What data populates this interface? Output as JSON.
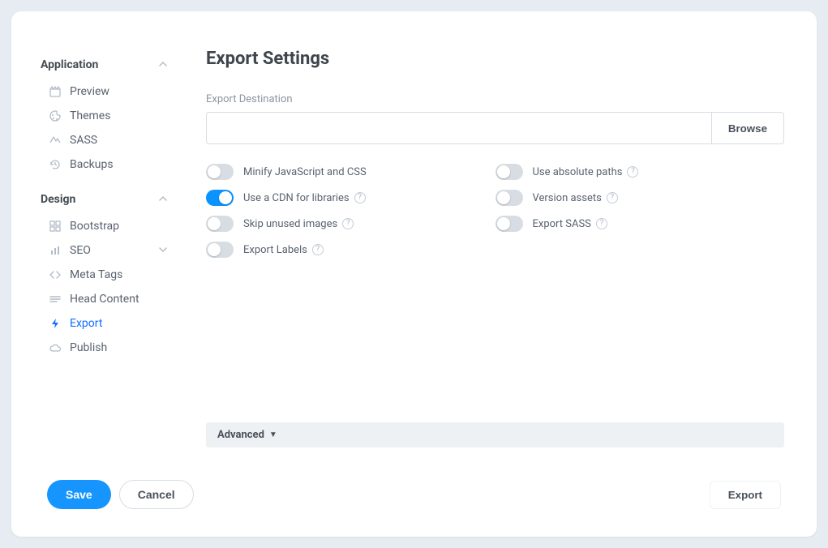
{
  "sidebar": {
    "sections": [
      {
        "title": "Application",
        "expanded": true,
        "items": [
          {
            "label": "Preview",
            "icon": "clapper"
          },
          {
            "label": "Themes",
            "icon": "palette"
          },
          {
            "label": "SASS",
            "icon": "sass"
          },
          {
            "label": "Backups",
            "icon": "history"
          }
        ]
      },
      {
        "title": "Design",
        "expanded": true,
        "items": [
          {
            "label": "Bootstrap",
            "icon": "grid"
          },
          {
            "label": "SEO",
            "icon": "bar-chart",
            "hasSubmenu": true
          },
          {
            "label": "Meta Tags",
            "icon": "code"
          },
          {
            "label": "Head Content",
            "icon": "lines"
          },
          {
            "label": "Export",
            "icon": "bolt",
            "active": true
          },
          {
            "label": "Publish",
            "icon": "cloud"
          }
        ]
      }
    ]
  },
  "main": {
    "title": "Export Settings",
    "destination": {
      "label": "Export Destination",
      "value": "",
      "browse": "Browse"
    },
    "toggles": [
      {
        "label": "Minify JavaScript and CSS",
        "on": false,
        "help": true
      },
      {
        "label": "Use absolute paths",
        "on": false,
        "help": true
      },
      {
        "label": "Use a CDN for libraries",
        "on": true,
        "help": true
      },
      {
        "label": "Version assets",
        "on": false,
        "help": true
      },
      {
        "label": "Skip unused images",
        "on": false,
        "help": true
      },
      {
        "label": "Export SASS",
        "on": false,
        "help": true
      },
      {
        "label": "Export Labels",
        "on": false,
        "help": true
      }
    ],
    "advanced": "Advanced"
  },
  "footer": {
    "save": "Save",
    "cancel": "Cancel",
    "export": "Export"
  }
}
